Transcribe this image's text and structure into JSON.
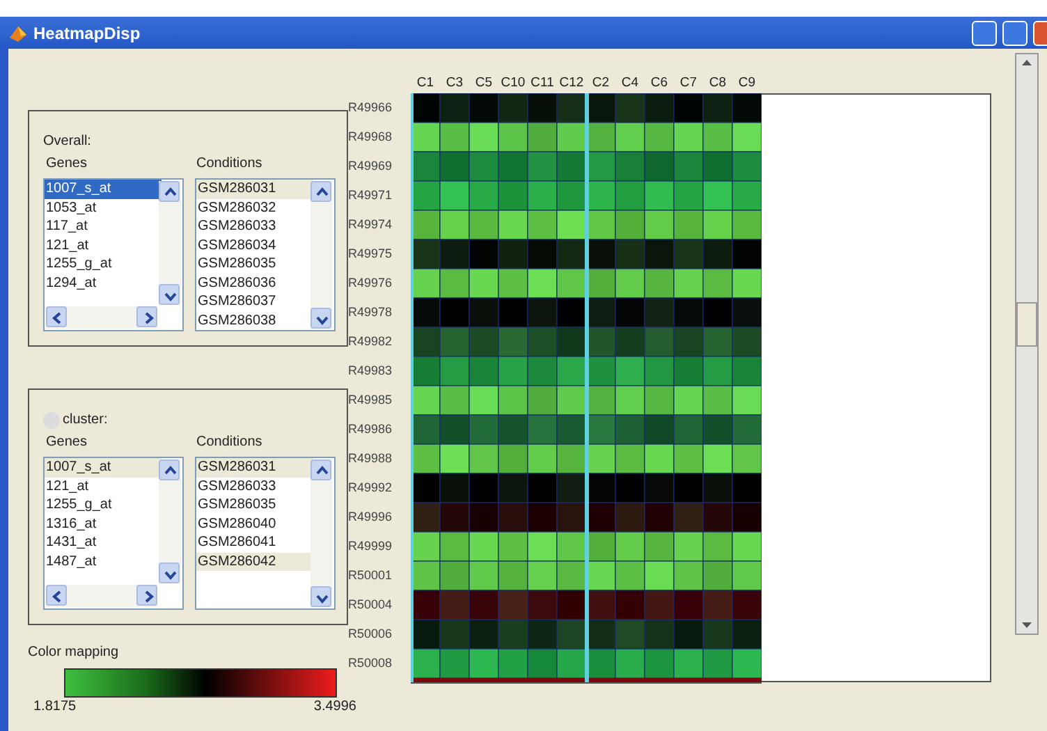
{
  "window": {
    "title": "HeatmapDisp"
  },
  "overall": {
    "label": "Overall:",
    "genes_heading": "Genes",
    "conditions_heading": "Conditions",
    "genes": {
      "focused": true,
      "items": [
        {
          "label": "1007_s_at",
          "selected": true
        },
        {
          "label": "1053_at",
          "selected": false
        },
        {
          "label": "117_at",
          "selected": false
        },
        {
          "label": "121_at",
          "selected": false
        },
        {
          "label": "1255_g_at",
          "selected": false
        },
        {
          "label": "1294_at",
          "selected": false
        }
      ]
    },
    "conditions": {
      "focused": false,
      "items": [
        {
          "label": "GSM286031",
          "selected": true
        },
        {
          "label": "GSM286032",
          "selected": false
        },
        {
          "label": "GSM286033",
          "selected": false
        },
        {
          "label": "GSM286034",
          "selected": false
        },
        {
          "label": "GSM286035",
          "selected": false
        },
        {
          "label": "GSM286036",
          "selected": false
        },
        {
          "label": "GSM286037",
          "selected": false
        },
        {
          "label": "GSM286038",
          "selected": false
        }
      ]
    }
  },
  "cluster": {
    "label": "cluster:",
    "genes_heading": "Genes",
    "conditions_heading": "Conditions",
    "genes": {
      "focused": false,
      "items": [
        {
          "label": "1007_s_at",
          "selected": true
        },
        {
          "label": "121_at",
          "selected": false
        },
        {
          "label": "1255_g_at",
          "selected": false
        },
        {
          "label": "1316_at",
          "selected": false
        },
        {
          "label": "1431_at",
          "selected": false
        },
        {
          "label": "1487_at",
          "selected": false
        }
      ]
    },
    "conditions": {
      "focused": false,
      "items": [
        {
          "label": "GSM286031",
          "selected": true
        },
        {
          "label": "GSM286033",
          "selected": false
        },
        {
          "label": "GSM286035",
          "selected": false
        },
        {
          "label": "GSM286040",
          "selected": false
        },
        {
          "label": "GSM286041",
          "selected": false
        },
        {
          "label": "GSM286042",
          "selected": true
        }
      ]
    }
  },
  "color_mapping": {
    "label": "Color mapping",
    "min": "1.8175",
    "max": "3.4996"
  },
  "heatmap": {
    "columns": [
      "C1",
      "C3",
      "C5",
      "C10",
      "C11",
      "C12",
      "C2",
      "C4",
      "C6",
      "C7",
      "C8",
      "C9"
    ],
    "rows": [
      "R49966",
      "R49968",
      "R49969",
      "R49971",
      "R49974",
      "R49975",
      "R49976",
      "R49978",
      "R49982",
      "R49983",
      "R49985",
      "R49986",
      "R49988",
      "R49992",
      "R49996",
      "R49999",
      "R50001",
      "R50004",
      "R50006",
      "R50008"
    ]
  }
}
